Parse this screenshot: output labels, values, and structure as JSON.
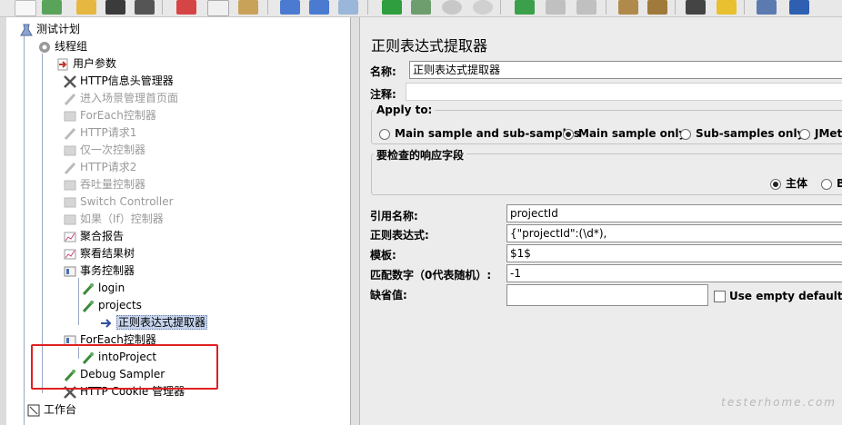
{
  "tree": {
    "nodes": [
      {
        "label": "测试计划",
        "icon": "test-plan-icon"
      },
      {
        "label": "线程组",
        "icon": "thread-group-icon"
      },
      {
        "label": "用户参数",
        "icon": "user-parameters-icon"
      },
      {
        "label": "HTTP信息头管理器",
        "icon": "header-manager-icon"
      },
      {
        "label": "进入场景管理首页面",
        "icon": "http-request-icon"
      },
      {
        "label": "ForEach控制器",
        "icon": "controller-icon"
      },
      {
        "label": "HTTP请求1",
        "icon": "http-request-icon"
      },
      {
        "label": "仅一次控制器",
        "icon": "controller-icon"
      },
      {
        "label": "HTTP请求2",
        "icon": "http-request-icon"
      },
      {
        "label": "吞吐量控制器",
        "icon": "controller-icon"
      },
      {
        "label": "Switch Controller",
        "icon": "controller-icon"
      },
      {
        "label": "如果（If）控制器",
        "icon": "controller-icon"
      },
      {
        "label": "聚合报告",
        "icon": "listener-icon"
      },
      {
        "label": "察看结果树",
        "icon": "listener-icon"
      },
      {
        "label": "事务控制器",
        "icon": "controller-icon"
      },
      {
        "label": "login",
        "icon": "sampler-icon"
      },
      {
        "label": "projects",
        "icon": "sampler-icon"
      },
      {
        "label": "正则表达式提取器",
        "icon": "extractor-icon"
      },
      {
        "label": "ForEach控制器",
        "icon": "controller-icon"
      },
      {
        "label": "intoProject",
        "icon": "sampler-icon"
      },
      {
        "label": "Debug Sampler",
        "icon": "sampler-icon"
      },
      {
        "label": "HTTP Cookie 管理器",
        "icon": "cookie-manager-icon"
      },
      {
        "label": "工作台",
        "icon": "workbench-icon"
      }
    ]
  },
  "panel": {
    "title": "正则表达式提取器",
    "name_label": "名称:",
    "name_value": "正则表达式提取器",
    "comment_label": "注释:",
    "apply_to": {
      "title": "Apply to:",
      "options": [
        "Main sample and sub-samples",
        "Main sample only",
        "Sub-samples only",
        "JMete"
      ],
      "selected": "Main sample only"
    },
    "response_field": {
      "title": "要检查的响应字段",
      "options": [
        "主体",
        "B"
      ],
      "selected": "主体"
    },
    "ref_name_label": "引用名称:",
    "ref_name_value": "projectId",
    "regex_label": "正则表达式:",
    "regex_value": "{\"projectId\":(\\d*),",
    "template_label": "模板:",
    "template_value": "$1$",
    "match_no_label": "匹配数字（0代表随机）:",
    "match_no_value": "-1",
    "default_label": "缺省值:",
    "default_value": "",
    "empty_default_label": "Use empty default valu"
  },
  "watermark": "testerhome.com",
  "colors": {
    "highlight_box": "#e02020",
    "selection": "#c5d3ec"
  }
}
